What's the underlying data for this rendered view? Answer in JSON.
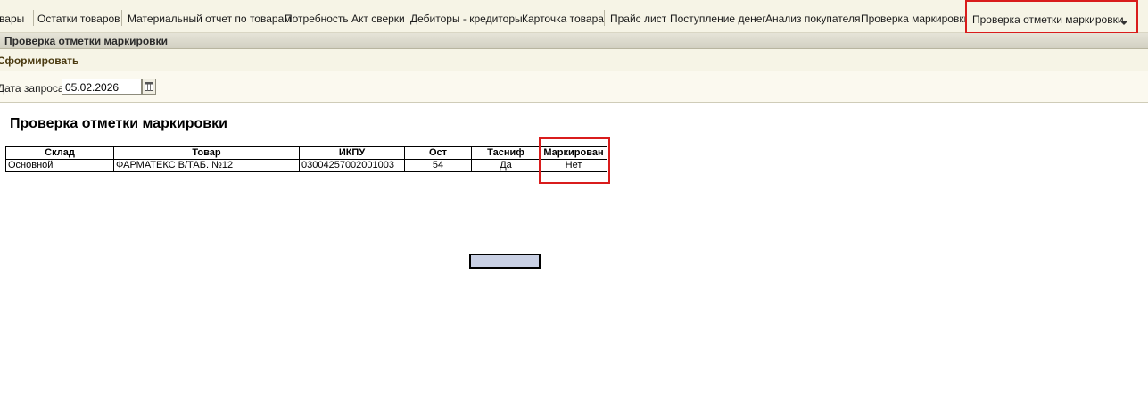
{
  "menu": {
    "items": [
      "Товары",
      "Остатки товаров",
      "Материальный отчет по товарам",
      "Потребность",
      "Акт сверки",
      "Дебиторы - кредиторы",
      "Карточка товара",
      "Прайс лист",
      "Поступление денег",
      "Анализ покупателя",
      "Проверка маркировки"
    ],
    "active": "Проверка отметки маркировки"
  },
  "window": {
    "title": "Проверка отметки маркировки"
  },
  "command": {
    "form_label": "Сформировать"
  },
  "params": {
    "date_label": "Дата запроса",
    "date_value": "05.02.2026"
  },
  "report": {
    "title": "Проверка отметки маркировки",
    "columns": [
      "Склад",
      "Товар",
      "ИКПУ",
      "Ост",
      "Тасниф",
      "Маркирован"
    ],
    "rows": [
      [
        "Основной",
        "ФАРМАТЕКС В/ТАБ. №12",
        "03004257002001003",
        "54",
        "Да",
        "Нет"
      ]
    ]
  },
  "colors": {
    "highlight": "#d91c1c",
    "menu_bg": "#f6f4e6"
  }
}
